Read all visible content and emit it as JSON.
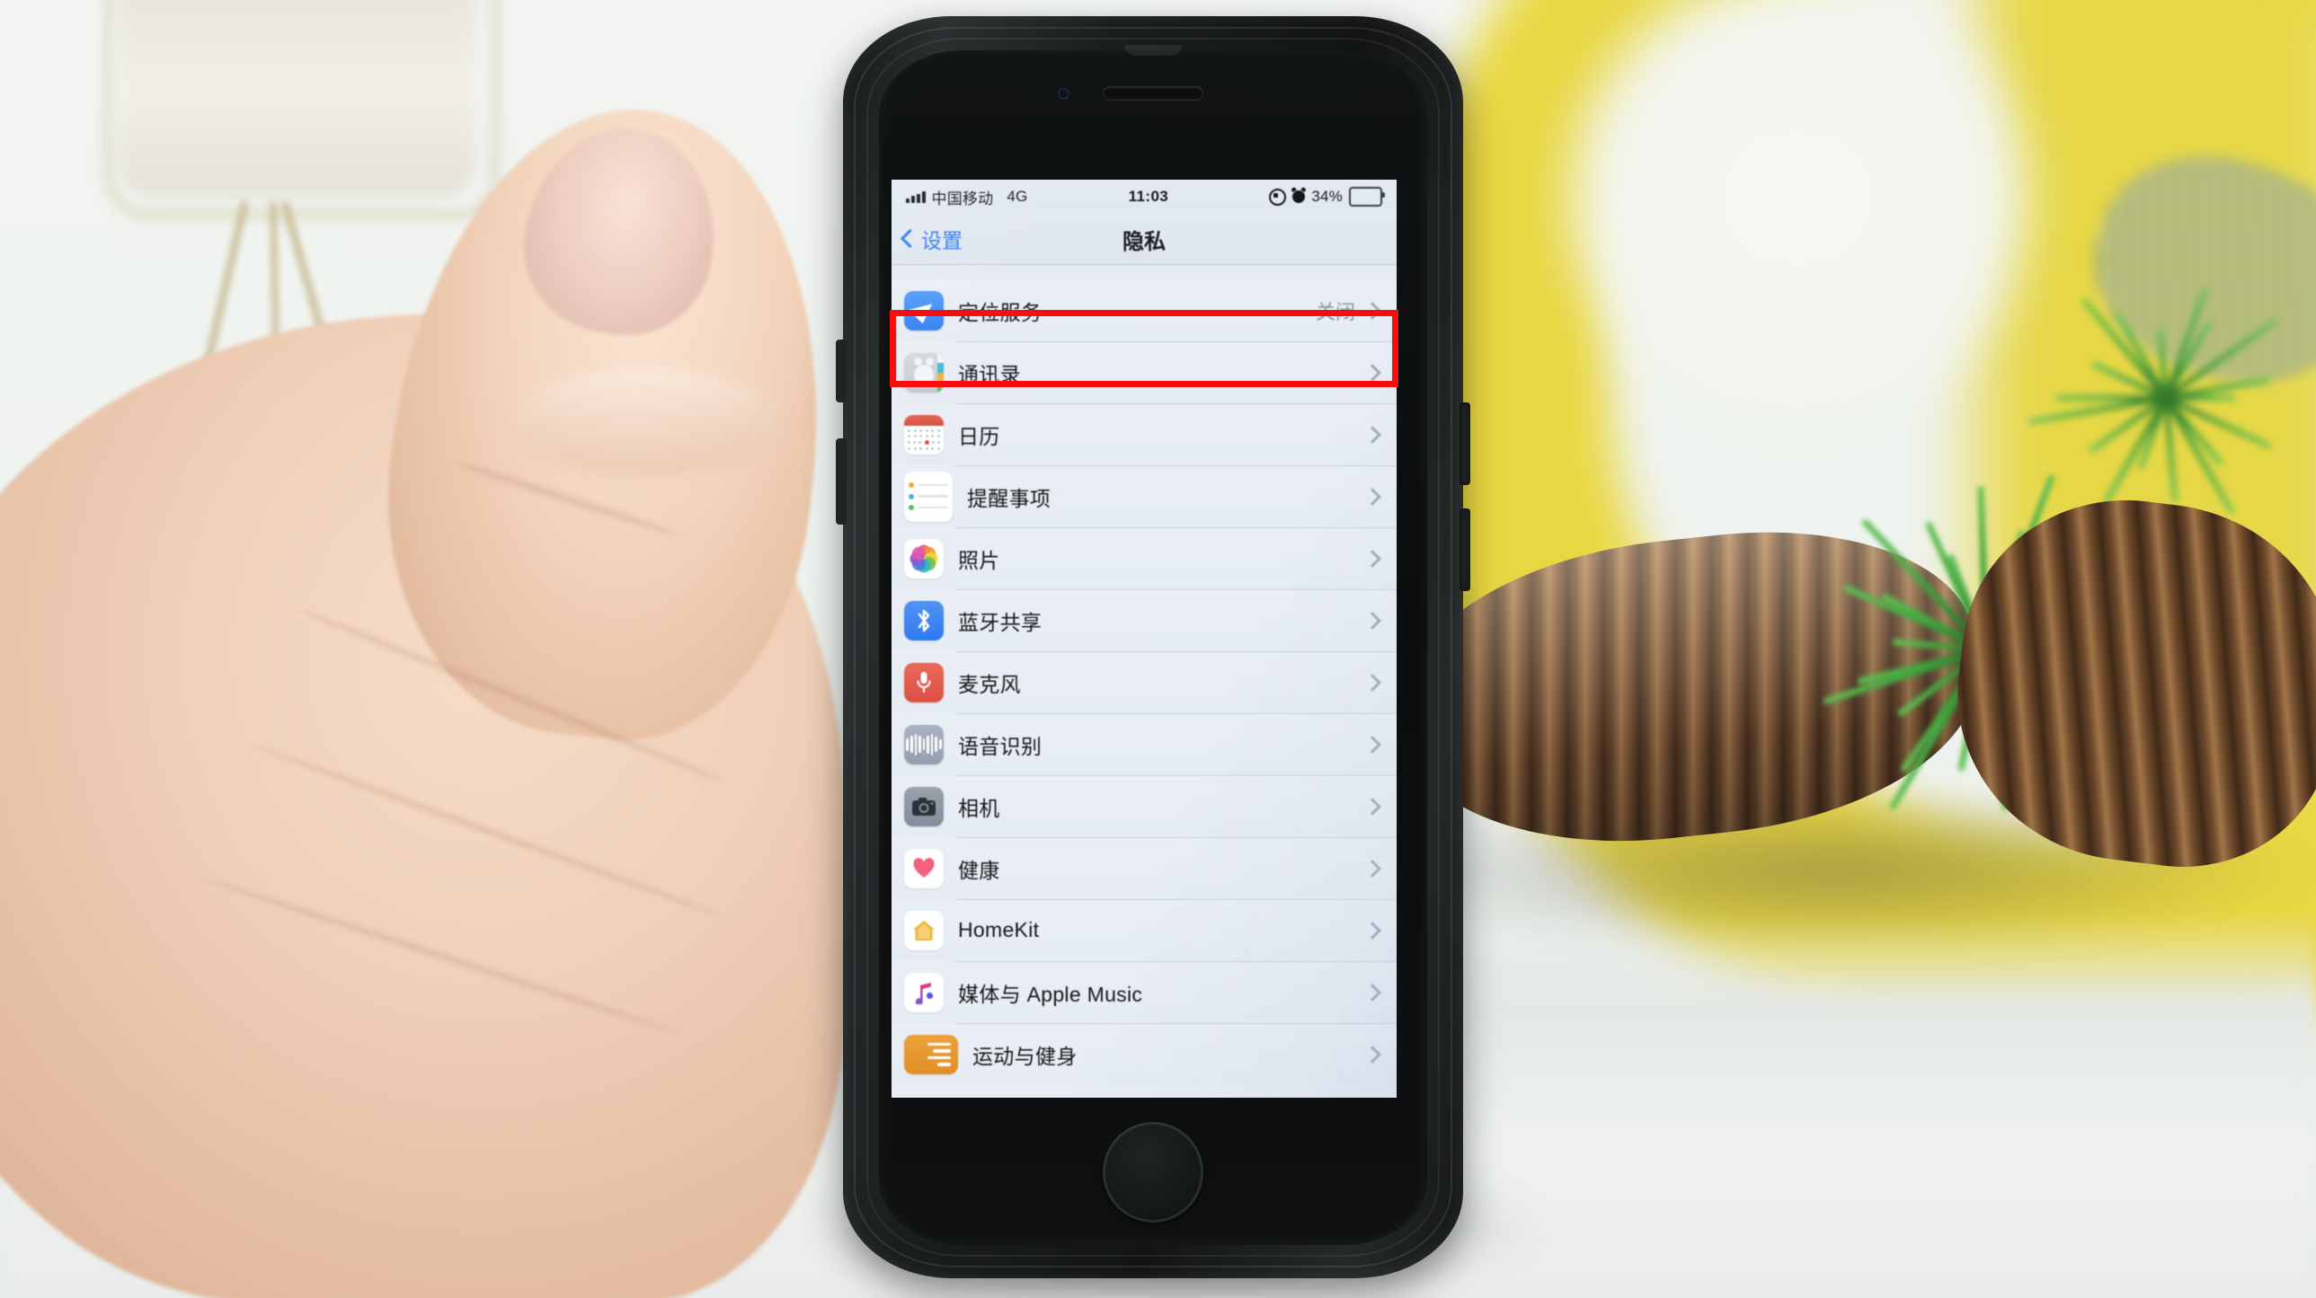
{
  "scene": {
    "description": "hand-held iPhone showing iOS Settings Privacy screen",
    "highlight_color": "#fb0d0d"
  },
  "status_bar": {
    "carrier": "中国移动",
    "network": "4G",
    "time": "11:03",
    "battery_percent": "34%",
    "battery_level": 34,
    "rotation_lock_icon": "rotation-lock-icon",
    "alarm_icon": "alarm-clock-icon",
    "signal_icon": "signal-bars-icon"
  },
  "nav_bar": {
    "back_label": "设置",
    "title": "隐私",
    "back_icon": "chevron-left-icon",
    "accent": "#2d7bf3"
  },
  "list": {
    "rows": [
      {
        "label": "定位服务",
        "value": "关闭",
        "icon": "location-arrow-icon",
        "highlighted": true
      },
      {
        "label": "通讯录",
        "value": "",
        "icon": "contacts-icon"
      },
      {
        "label": "日历",
        "value": "",
        "icon": "calendar-icon"
      },
      {
        "label": "提醒事项",
        "value": "",
        "icon": "reminders-icon"
      },
      {
        "label": "照片",
        "value": "",
        "icon": "photos-icon"
      },
      {
        "label": "蓝牙共享",
        "value": "",
        "icon": "bluetooth-icon"
      },
      {
        "label": "麦克风",
        "value": "",
        "icon": "microphone-icon"
      },
      {
        "label": "语音识别",
        "value": "",
        "icon": "speech-recognition-icon"
      },
      {
        "label": "相机",
        "value": "",
        "icon": "camera-icon"
      },
      {
        "label": "健康",
        "value": "",
        "icon": "health-heart-icon"
      },
      {
        "label": "HomeKit",
        "value": "",
        "icon": "homekit-house-icon"
      },
      {
        "label": "媒体与 Apple Music",
        "value": "",
        "icon": "apple-music-note-icon"
      },
      {
        "label": "运动与健身",
        "value": "",
        "icon": "motion-fitness-icon"
      }
    ],
    "chevron_icon": "chevron-right-icon"
  }
}
